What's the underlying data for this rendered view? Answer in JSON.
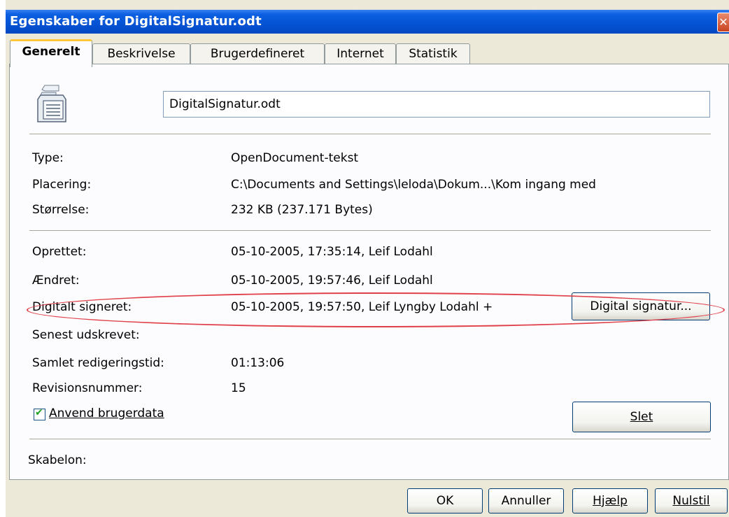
{
  "window": {
    "title": "Egenskaber for DigitalSignatur.odt",
    "close_glyph": "✕"
  },
  "tabs": [
    {
      "label": "Generelt"
    },
    {
      "label": "Beskrivelse"
    },
    {
      "label": "Brugerdefineret"
    },
    {
      "label": "Internet"
    },
    {
      "label": "Statistik"
    }
  ],
  "general": {
    "filename": "DigitalSignatur.odt",
    "type_label": "Type:",
    "type_value": "OpenDocument-tekst",
    "location_label": "Placering:",
    "location_value": "C:\\Documents and Settings\\leloda\\Dokum...\\Kom ingang med",
    "size_label": "Størrelse:",
    "size_value": "232 KB (237.171 Bytes)",
    "created_label": "Oprettet:",
    "created_value": "05-10-2005, 17:35:14, Leif Lodahl",
    "modified_label": "Ændret:",
    "modified_value": "05-10-2005, 19:57:46, Leif Lodahl",
    "signed_label": "Digitalt signeret:",
    "signed_value": "05-10-2005, 19:57:50, Leif Lyngby Lodahl +",
    "digital_signature_button": "Digital signatur...",
    "printed_label": "Senest udskrevet:",
    "editing_time_label": "Samlet redigeringstid:",
    "editing_time_value": "01:13:06",
    "revision_label": "Revisionsnummer:",
    "revision_value": "15",
    "use_user_data_label": "Anvend brugerdata",
    "use_user_data_checked": true,
    "delete_button": "Slet",
    "template_label": "Skabelon:"
  },
  "footer": {
    "ok": "OK",
    "cancel": "Annuller",
    "help": "Hjælp",
    "reset": "Nulstil"
  },
  "icons": {
    "document_icon": "writer-document-icon",
    "check_icon": "check-icon",
    "close_icon": "close-icon"
  },
  "colors": {
    "titlebar": "#0453d4",
    "highlight": "#e0404a",
    "active_tab_accent": "#ffc83c"
  }
}
